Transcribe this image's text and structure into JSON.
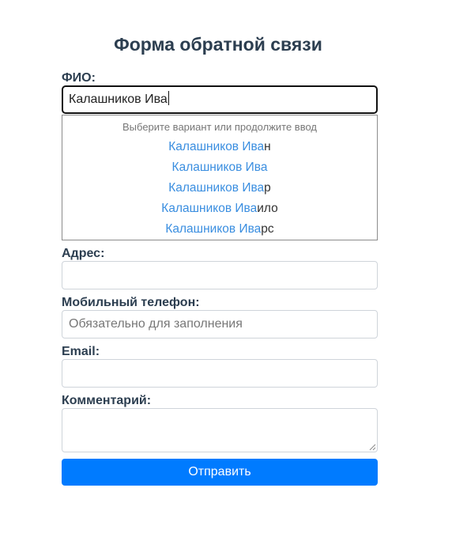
{
  "form": {
    "title": "Форма обратной связи",
    "fio": {
      "label": "ФИО:",
      "value": "Калашников Ива"
    },
    "autocomplete": {
      "hint": "Выберите вариант или продолжите ввод",
      "items": [
        {
          "match": "Калашников Ива",
          "rest": "н"
        },
        {
          "match": "Калашников Ива",
          "rest": ""
        },
        {
          "match": "Калашников Ива",
          "rest": "р"
        },
        {
          "match": "Калашников Ива",
          "rest": "ило"
        },
        {
          "match": "Калашников Ива",
          "rest": "рс"
        }
      ]
    },
    "address": {
      "label": "Адрес:",
      "value": ""
    },
    "phone": {
      "label": "Мобильный телефон:",
      "placeholder": "Обязательно для заполнения"
    },
    "email": {
      "label": "Email:",
      "value": ""
    },
    "comment": {
      "label": "Комментарий:",
      "value": ""
    },
    "submit_label": "Отправить"
  },
  "colors": {
    "accent": "#007bff",
    "suggestion_match": "#3a8ee0",
    "label_text": "#2c3e50"
  }
}
